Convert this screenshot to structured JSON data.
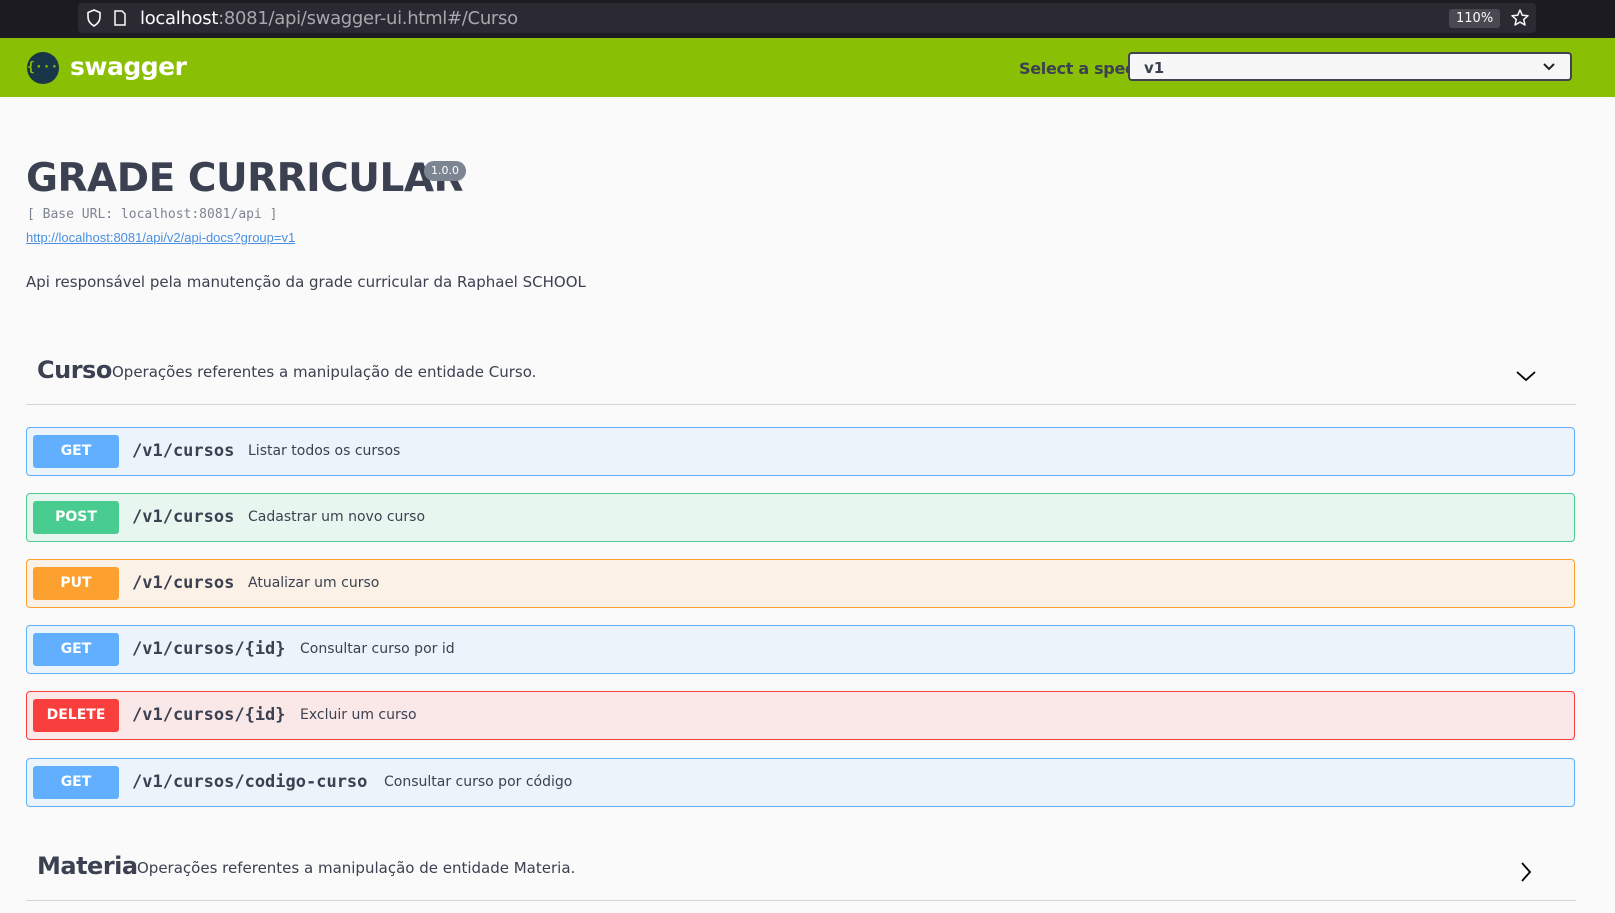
{
  "browser": {
    "url_host": "localhost",
    "url_rest": ":8081/api/swagger-ui.html#/Curso",
    "zoom": "110%"
  },
  "topbar": {
    "logo_text": "swagger",
    "logo_glyph": "{···}",
    "spec_label": "Select a spec",
    "spec_value": "v1"
  },
  "info": {
    "title": "GRADE CURRICULAR",
    "version": "1.0.0",
    "base_url": "[ Base URL: localhost:8081/api ]",
    "spec_link": "http://localhost:8081/api/v2/api-docs?group=v1",
    "description": "Api responsável pela manutenção da grade curricular da Raphael SCHOOL"
  },
  "tags": [
    {
      "name": "Curso",
      "description": "Operações referentes a manipulação de entidade Curso.",
      "expanded": true,
      "operations": [
        {
          "method": "GET",
          "path": "/v1/cursos",
          "summary": "Listar todos os cursos"
        },
        {
          "method": "POST",
          "path": "/v1/cursos",
          "summary": "Cadastrar um novo curso"
        },
        {
          "method": "PUT",
          "path": "/v1/cursos",
          "summary": "Atualizar um curso"
        },
        {
          "method": "GET",
          "path": "/v1/cursos/{id}",
          "summary": "Consultar curso por id"
        },
        {
          "method": "DELETE",
          "path": "/v1/cursos/{id}",
          "summary": "Excluir um curso"
        },
        {
          "method": "GET",
          "path": "/v1/cursos/codigo-curso",
          "summary": "Consultar curso por código"
        }
      ]
    },
    {
      "name": "Materia",
      "description": "Operações referentes a manipulação de entidade Materia.",
      "expanded": false,
      "operations": []
    }
  ],
  "colors": {
    "topbar": "#89bf04",
    "get": "#61affe",
    "post": "#49cc90",
    "put": "#fca130",
    "delete": "#f93e3e"
  }
}
